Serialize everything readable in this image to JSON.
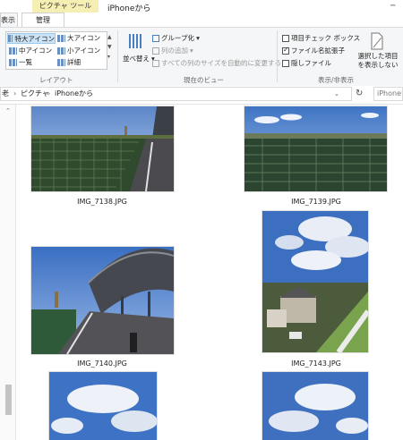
{
  "window": {
    "context_tab": "ピクチャ ツール",
    "title": "iPhoneから",
    "tabs": [
      "表示",
      "管理"
    ]
  },
  "ribbon": {
    "layout": {
      "items": [
        "特大アイコン",
        "大アイコン",
        "中アイコン",
        "小アイコン",
        "一覧",
        "詳細"
      ],
      "label": "レイアウト"
    },
    "current_view": {
      "sort": "並べ替え",
      "group": "グループ化",
      "add_column": "列の追加",
      "fit_columns": "すべての列のサイズを自動的に変更する",
      "label": "現在のビュー"
    },
    "show_hide": {
      "item_checkbox": "項目チェック ボックス",
      "file_extensions": "ファイル名拡張子",
      "hidden_files": "隠しファイル",
      "hide_selected": "選択した項目を表示しない",
      "label": "表示/非表示"
    }
  },
  "address": {
    "crumbs": [
      "老",
      "ピクチャ",
      "iPhoneから"
    ],
    "search_placeholder": "iPhoneか"
  },
  "files": [
    {
      "name": "IMG_7138.JPG"
    },
    {
      "name": "IMG_7139.JPG"
    },
    {
      "name": "IMG_7140.JPG"
    },
    {
      "name": "IMG_7143.JPG"
    }
  ]
}
